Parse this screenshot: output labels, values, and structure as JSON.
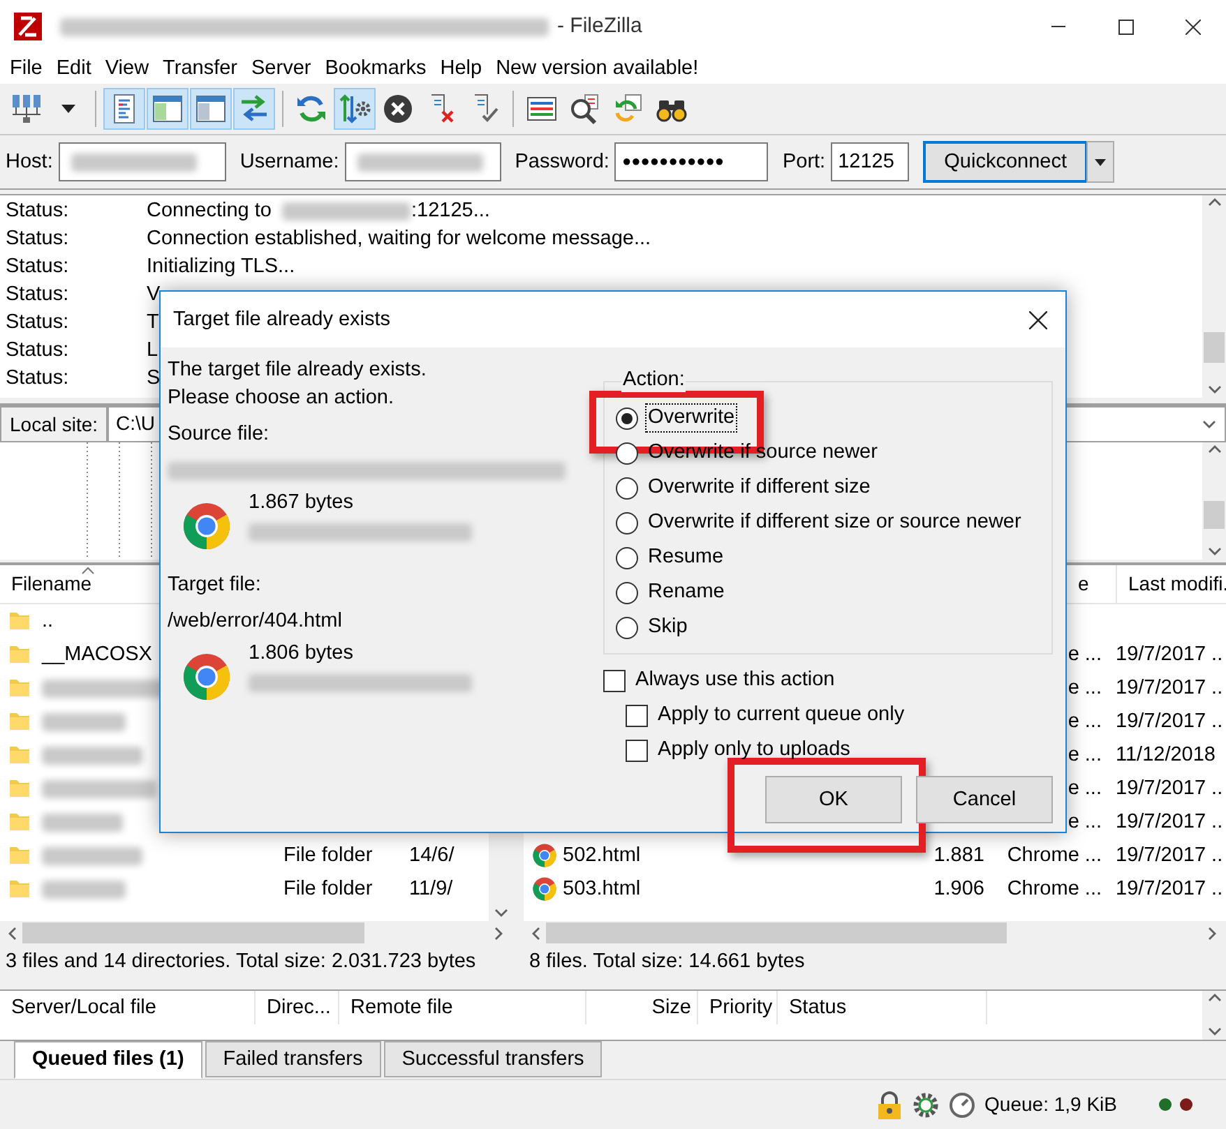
{
  "window": {
    "title_redacted": true,
    "title": "- FileZilla"
  },
  "menu": [
    "File",
    "Edit",
    "View",
    "Transfer",
    "Server",
    "Bookmarks",
    "Help",
    "New version available!"
  ],
  "toolbar": [
    {
      "kind": "site-manager",
      "pressed": false
    },
    {
      "kind": "dropdown",
      "pressed": false
    },
    {
      "kind": "separator"
    },
    {
      "kind": "log",
      "pressed": true
    },
    {
      "kind": "local-tree",
      "pressed": true
    },
    {
      "kind": "remote-tree",
      "pressed": true
    },
    {
      "kind": "transfer-queue",
      "pressed": true
    },
    {
      "kind": "separator"
    },
    {
      "kind": "refresh",
      "pressed": false
    },
    {
      "kind": "process-queue",
      "pressed": true
    },
    {
      "kind": "cancel",
      "pressed": false
    },
    {
      "kind": "disconnect",
      "pressed": false
    },
    {
      "kind": "reconnect",
      "pressed": false
    },
    {
      "kind": "separator"
    },
    {
      "kind": "filter",
      "pressed": false
    },
    {
      "kind": "compare",
      "pressed": false
    },
    {
      "kind": "sync",
      "pressed": false
    },
    {
      "kind": "search",
      "pressed": false
    }
  ],
  "quickconnect": {
    "fields": [
      {
        "label": "Host:",
        "redacted": true
      },
      {
        "label": "Username:",
        "redacted": true
      },
      {
        "label": "Password:",
        "value": "●●●●●●●●●●●"
      },
      {
        "label": "Port:",
        "value": "12125"
      }
    ],
    "button": "Quickconnect"
  },
  "log": [
    {
      "label": "Status:",
      "message": "Connecting to",
      "redacted": true,
      "suffix": ":12125..."
    },
    {
      "label": "Status:",
      "message": "Connection established, waiting for welcome message..."
    },
    {
      "label": "Status:",
      "message": "Initializing TLS..."
    },
    {
      "label": "Status:",
      "message": "V"
    },
    {
      "label": "Status:",
      "message": "T"
    },
    {
      "label": "Status:",
      "message": "L"
    },
    {
      "label": "Status:",
      "message": "S"
    }
  ],
  "local_site": {
    "label": "Local site:",
    "path": "C:\\U"
  },
  "local_files": {
    "columns": [
      "Filename"
    ],
    "rows": [
      {
        "name": ".."
      },
      {
        "name": "__MACOSX"
      },
      {
        "redacted": true
      },
      {
        "redacted": true
      },
      {
        "redacted": true
      },
      {
        "redacted": true
      },
      {
        "redacted": true
      },
      {
        "redacted": true,
        "type": "File folder",
        "modified": "14/6/"
      },
      {
        "redacted": true,
        "type": "File folder",
        "modified": "11/9/"
      }
    ],
    "summary": "3 files and 14 directories. Total size: 2.031.723 bytes"
  },
  "remote_files": {
    "columns": [
      "e",
      "Last modifi."
    ],
    "rows": [
      {
        "type": "e ...",
        "modified": "19/7/2017 .."
      },
      {
        "type": "e ...",
        "modified": "19/7/2017 .."
      },
      {
        "type": "e ...",
        "modified": "19/7/2017 .."
      },
      {
        "type": "e ...",
        "modified": "11/12/2018"
      },
      {
        "type": "e ...",
        "modified": "19/7/2017 .."
      },
      {
        "type": "e ...",
        "modified": "19/7/2017 .."
      },
      {
        "name": "502.html",
        "size": "1.881",
        "type": "Chrome ...",
        "modified": "19/7/2017 .."
      },
      {
        "name": "503.html",
        "size": "1.906",
        "type": "Chrome ...",
        "modified": "19/7/2017 .."
      }
    ],
    "summary": "8 files. Total size: 14.661 bytes"
  },
  "queue": {
    "columns": [
      "Server/Local file",
      "Direc...",
      "Remote file",
      "Size",
      "Priority",
      "Status"
    ],
    "tabs": [
      {
        "label": "Queued files (1)",
        "selected": true
      },
      {
        "label": "Failed transfers",
        "selected": false
      },
      {
        "label": "Successful transfers",
        "selected": false
      }
    ]
  },
  "status_bar": {
    "queue": "Queue: 1,9 KiB",
    "lights": [
      {
        "color": "#1f6e2a"
      },
      {
        "color": "#7d1a1a"
      }
    ]
  },
  "dialog": {
    "title": "Target file already exists",
    "intro": [
      "The target file already exists.",
      "Please choose an action."
    ],
    "files": [
      {
        "label": "Source file:",
        "path_redacted": true,
        "size": "1.867 bytes",
        "date_redacted": true
      },
      {
        "label": "Target file:",
        "path": "/web/error/404.html",
        "size": "1.806 bytes",
        "date_redacted": true
      }
    ],
    "action_label": "Action:",
    "actions": [
      {
        "label": "Overwrite",
        "selected": true,
        "highlighted": true
      },
      {
        "label": "Overwrite if source newer",
        "selected": false,
        "highlighted": false
      },
      {
        "label": "Overwrite if different size",
        "selected": false,
        "highlighted": false
      },
      {
        "label": "Overwrite if different size or source newer",
        "selected": false,
        "highlighted": false
      },
      {
        "label": "Resume",
        "selected": false,
        "highlighted": false
      },
      {
        "label": "Rename",
        "selected": false,
        "highlighted": false
      },
      {
        "label": "Skip",
        "selected": false,
        "highlighted": false
      }
    ],
    "options": [
      {
        "label": "Always use this action",
        "checked": false,
        "children": [
          {
            "label": "Apply to current queue only",
            "checked": false
          },
          {
            "label": "Apply only to uploads",
            "checked": false
          }
        ]
      }
    ],
    "buttons": [
      {
        "label": "OK",
        "highlighted": true
      },
      {
        "label": "Cancel",
        "highlighted": false
      }
    ]
  }
}
